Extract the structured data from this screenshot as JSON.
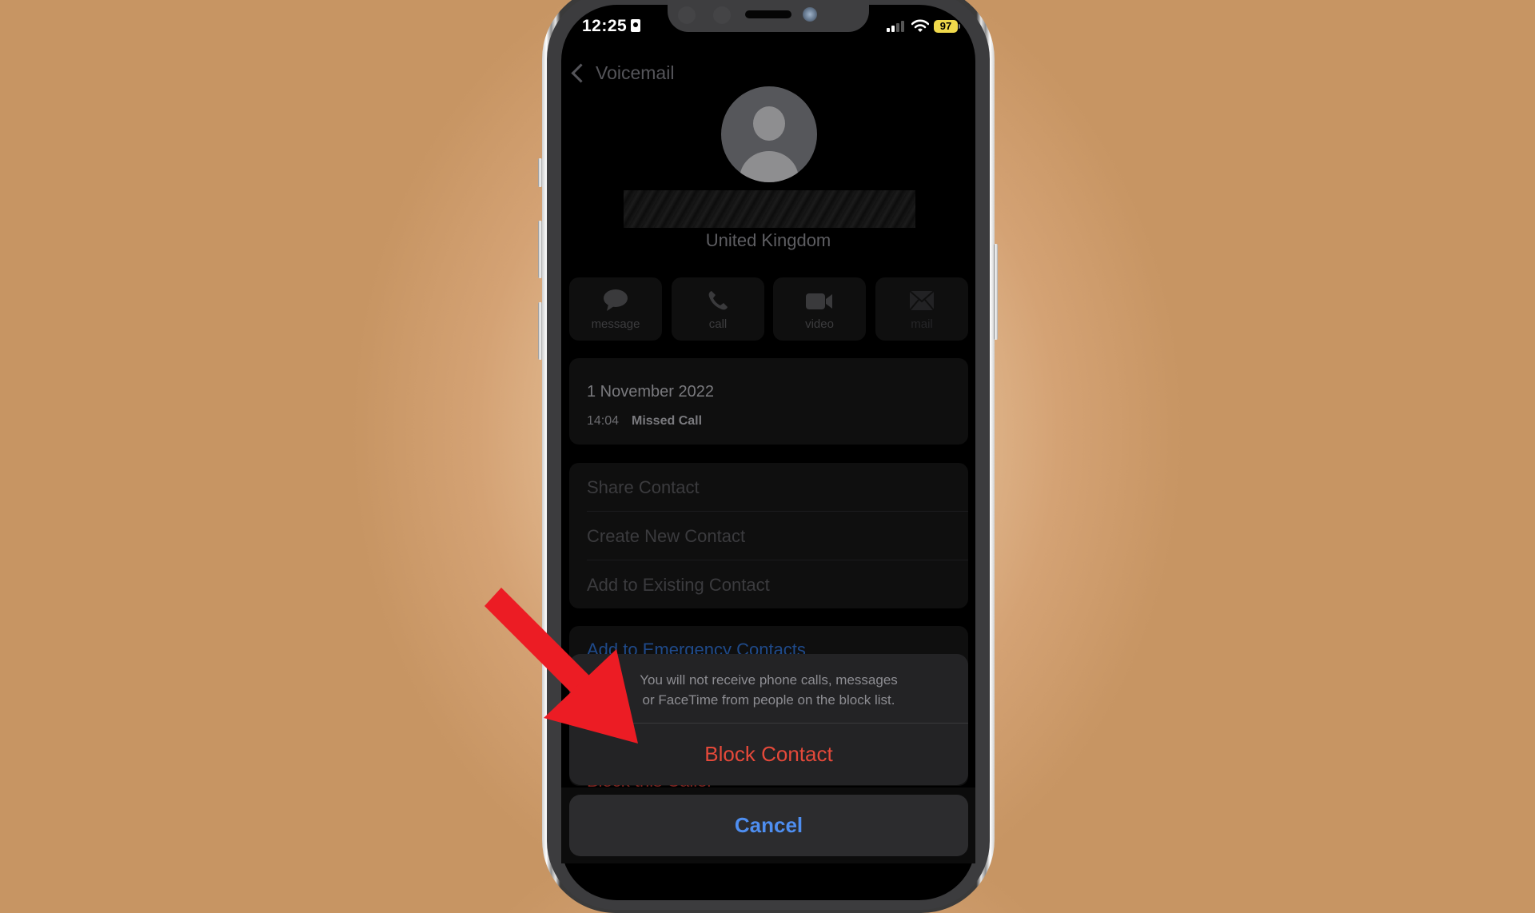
{
  "status_bar": {
    "time": "12:25",
    "battery": "97",
    "signal_bars_active": 2,
    "signal_bars_total": 4
  },
  "nav": {
    "back_label": "Voicemail"
  },
  "contact": {
    "name": "",
    "location": "United Kingdom"
  },
  "actions": [
    {
      "label": "message",
      "icon": "message-bubble-icon"
    },
    {
      "label": "call",
      "icon": "phone-icon"
    },
    {
      "label": "video",
      "icon": "video-camera-icon"
    },
    {
      "label": "mail",
      "icon": "envelope-icon"
    }
  ],
  "call_log": {
    "date": "1 November 2022",
    "time": "14:04",
    "type": "Missed Call"
  },
  "options": [
    "Share Contact",
    "Create New Contact",
    "Add to Existing Contact"
  ],
  "emergency_label": "Add to Emergency Contacts",
  "block_caller_label": "Block this Caller",
  "action_sheet": {
    "message": "You will not receive phone calls, messages or FaceTime from people on the block list.",
    "confirm_label": "Block Contact",
    "cancel_label": "Cancel"
  },
  "colors": {
    "destructive": "#e5493a",
    "cancel": "#4e8ef0",
    "battery": "#f0d94b",
    "annotation_arrow": "#ec1c24",
    "background": "#d4a274"
  }
}
